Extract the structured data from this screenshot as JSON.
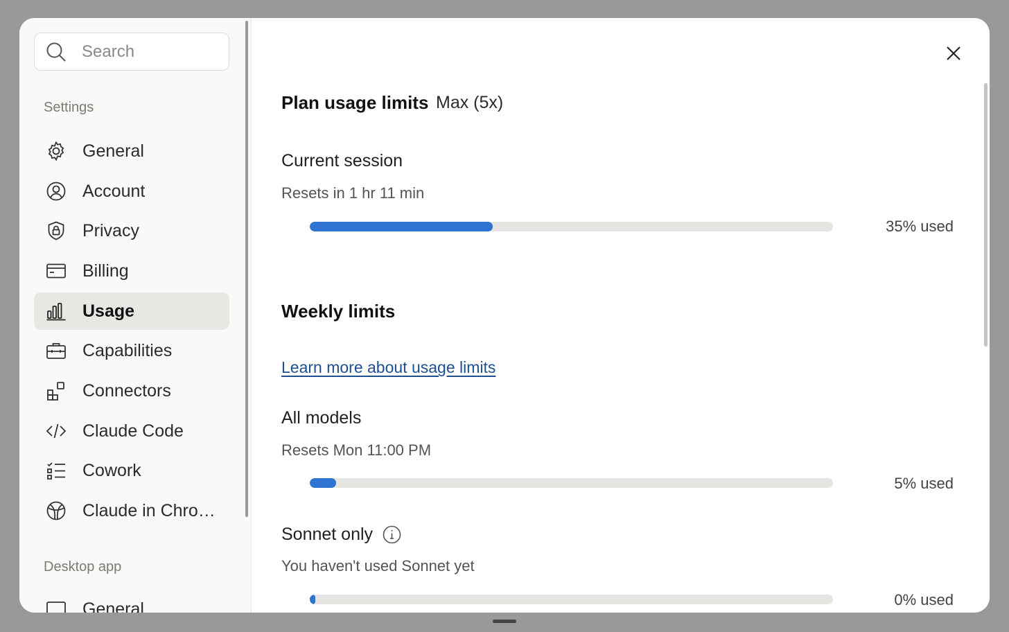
{
  "search": {
    "placeholder": "Search"
  },
  "sidebar": {
    "settings_label": "Settings",
    "items": [
      {
        "label": "General",
        "icon": "gear-icon"
      },
      {
        "label": "Account",
        "icon": "user-circle-icon"
      },
      {
        "label": "Privacy",
        "icon": "shield-lock-icon"
      },
      {
        "label": "Billing",
        "icon": "credit-card-icon"
      },
      {
        "label": "Usage",
        "icon": "bar-chart-icon",
        "active": true
      },
      {
        "label": "Capabilities",
        "icon": "briefcase-icon"
      },
      {
        "label": "Connectors",
        "icon": "connectors-icon"
      },
      {
        "label": "Claude Code",
        "icon": "code-icon"
      },
      {
        "label": "Cowork",
        "icon": "checklist-icon"
      },
      {
        "label": "Claude in Chro…",
        "icon": "globe-icon"
      }
    ],
    "desktop_label": "Desktop app",
    "desktop_items": [
      {
        "label": "General",
        "icon": "window-icon"
      }
    ]
  },
  "main": {
    "title": "Plan usage limits",
    "plan": "Max (5x)",
    "current_session": {
      "title": "Current session",
      "resets": "Resets in 1 hr 11 min",
      "used_fraction": 0.35,
      "used_label": "35% used"
    },
    "weekly": {
      "title": "Weekly limits",
      "learn_more": "Learn more about usage limits",
      "all_models": {
        "title": "All models",
        "resets": "Resets Mon 11:00 PM",
        "used_fraction": 0.05,
        "used_label": "5% used"
      },
      "sonnet": {
        "title": "Sonnet only",
        "note": "You haven't used Sonnet yet",
        "used_fraction": 0.0,
        "used_label": "0% used"
      }
    }
  },
  "colors": {
    "accent": "#2f74d0",
    "track": "#e6e5e2",
    "link": "#1d4f91"
  }
}
